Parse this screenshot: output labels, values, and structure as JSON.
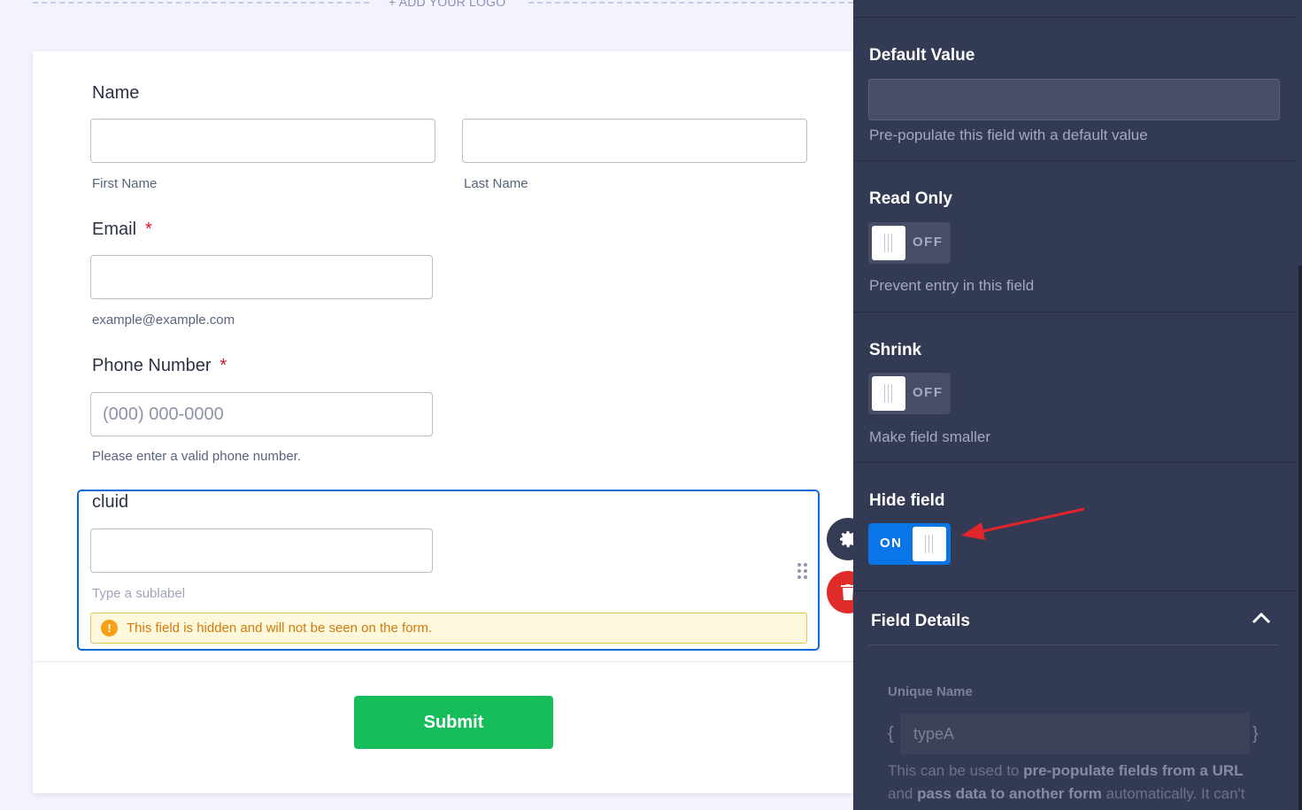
{
  "logo": {
    "add_logo": "+ ADD YOUR LOGO"
  },
  "form": {
    "name_field": {
      "label": "Name",
      "first_sublabel": "First Name",
      "last_sublabel": "Last Name"
    },
    "email_field": {
      "label": "Email",
      "required_mark": "*",
      "sublabel": "example@example.com"
    },
    "phone_field": {
      "label": "Phone Number",
      "required_mark": "*",
      "placeholder": "(000) 000-0000",
      "sublabel": "Please enter a valid phone number."
    },
    "cluid_field": {
      "label": "cluid",
      "sublabel_placeholder": "Type a sublabel",
      "hidden_notice": "This field is hidden and will not be seen on the form."
    },
    "submit_label": "Submit"
  },
  "panel": {
    "default_value": {
      "title": "Default Value",
      "description": "Pre-populate this field with a default value"
    },
    "read_only": {
      "title": "Read Only",
      "state": "OFF",
      "description": "Prevent entry in this field"
    },
    "shrink": {
      "title": "Shrink",
      "state": "OFF",
      "description": "Make field smaller"
    },
    "hide_field": {
      "title": "Hide field",
      "state": "ON"
    },
    "field_details": {
      "title": "Field Details",
      "unique_name_label": "Unique Name",
      "open_brace": "{",
      "close_brace": "}",
      "unique_name_value": "typeA",
      "desc_part1": "This can be used to ",
      "desc_bold1": "pre-populate fields from a URL",
      "desc_part2": " and ",
      "desc_bold2": "pass data to another form",
      "desc_part3": " automatically. It can't include"
    }
  },
  "colors": {
    "accent": "#0a6bd8",
    "submit": "#18bd5b",
    "panel_bg": "#333a53",
    "toggle_on": "#0a75e6",
    "annotation_arrow": "#e0262b"
  }
}
